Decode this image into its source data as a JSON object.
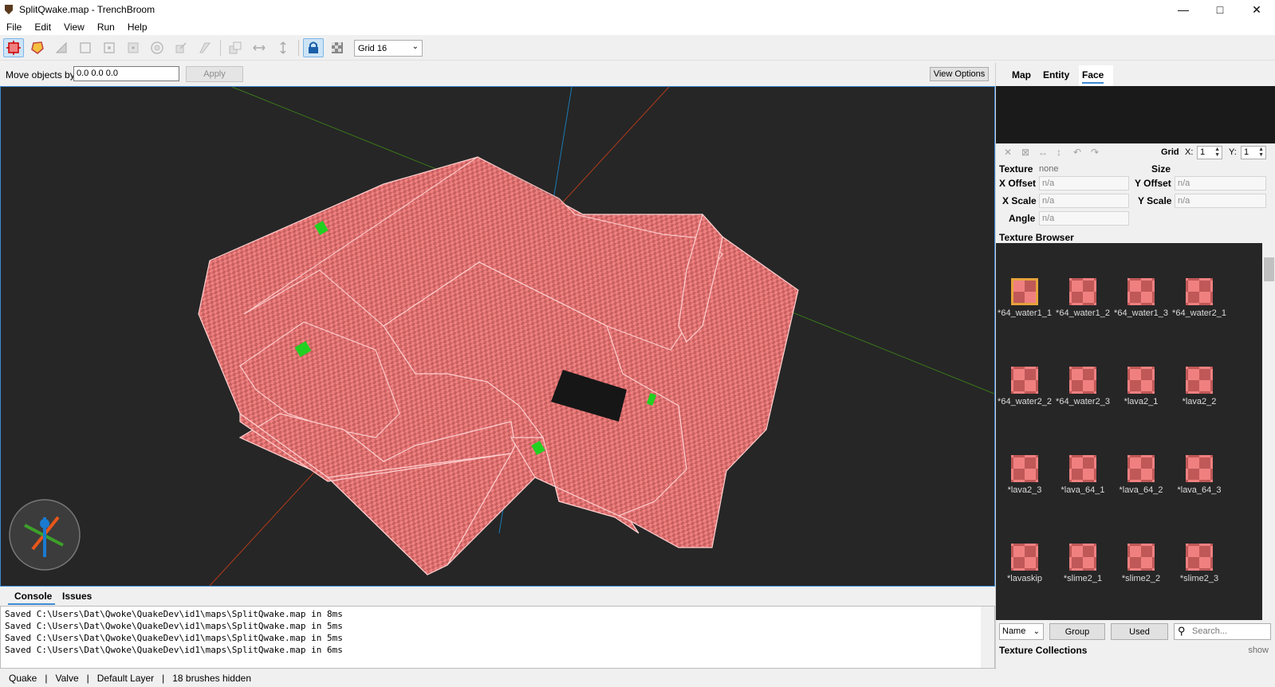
{
  "window": {
    "title": "SplitQwake.map - TrenchBroom"
  },
  "menu": [
    "File",
    "Edit",
    "View",
    "Run",
    "Help"
  ],
  "toolbar": {
    "grid_select": "Grid 16"
  },
  "move_bar": {
    "label": "Move objects by",
    "value": "0.0 0.0 0.0",
    "apply": "Apply",
    "view_options": "View Options"
  },
  "console": {
    "tabs": [
      "Console",
      "Issues"
    ],
    "lines": [
      "Saved C:\\Users\\Dat\\Qwoke\\QuakeDev\\id1\\maps\\SplitQwake.map in 8ms",
      "Saved C:\\Users\\Dat\\Qwoke\\QuakeDev\\id1\\maps\\SplitQwake.map in 5ms",
      "Saved C:\\Users\\Dat\\Qwoke\\QuakeDev\\id1\\maps\\SplitQwake.map in 5ms",
      "Saved C:\\Users\\Dat\\Qwoke\\QuakeDev\\id1\\maps\\SplitQwake.map in 6ms"
    ]
  },
  "status": {
    "game": "Quake",
    "format": "Valve",
    "layer": "Default Layer",
    "hidden": "18 brushes hidden"
  },
  "right_panel": {
    "tabs": [
      "Map",
      "Entity",
      "Face"
    ],
    "grid": {
      "label": "Grid",
      "x_label": "X:",
      "x": "1",
      "y_label": "Y:",
      "y": "1"
    },
    "props": {
      "texture_label": "Texture",
      "texture": "none",
      "size_label": "Size",
      "x_offset_label": "X Offset",
      "x_offset": "n/a",
      "y_offset_label": "Y Offset",
      "y_offset": "n/a",
      "x_scale_label": "X Scale",
      "x_scale": "n/a",
      "y_scale_label": "Y Scale",
      "y_scale": "n/a",
      "angle_label": "Angle",
      "angle": "n/a"
    },
    "texture_browser_title": "Texture Browser",
    "textures": [
      "*64_water1_1",
      "*64_water1_2",
      "*64_water1_3",
      "*64_water2_1",
      "*64_water2_2",
      "*64_water2_3",
      "*lava2_1",
      "*lava2_2",
      "*lava2_3",
      "*lava_64_1",
      "*lava_64_2",
      "*lava_64_3",
      "*lavaskip",
      "*slime2_1",
      "*slime2_2",
      "*slime2_3"
    ],
    "sort": "Name",
    "group": "Group",
    "used": "Used",
    "search_placeholder": "Search...",
    "collections_title": "Texture Collections",
    "show": "show"
  },
  "colors": {
    "texture_fill": "#f08080",
    "texture_dark": "#c05858",
    "viewport_bg": "#262626",
    "accent": "#3c8ad4"
  }
}
